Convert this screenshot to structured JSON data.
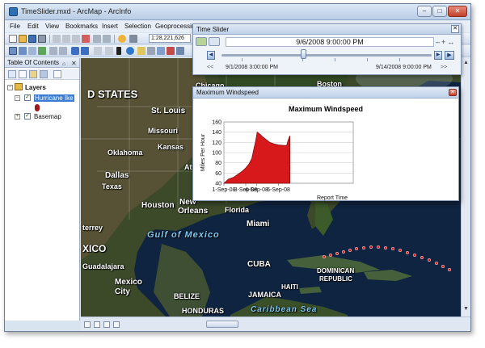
{
  "window": {
    "title": "TimeSlider.mxd - ArcMap - ArcInfo",
    "min_label": "–",
    "max_label": "□",
    "close_label": "✕"
  },
  "menubar": {
    "items": [
      "File",
      "Edit",
      "View",
      "Bookmarks",
      "Insert",
      "Selection",
      "Geoprocessing"
    ]
  },
  "toolbar": {
    "scale": "1:28,221,626"
  },
  "toc": {
    "title": "Table Of Contents",
    "pin": "⌂",
    "close": "✕",
    "layers_label": "Layers",
    "hurricane_label": "Hurricane Ike",
    "basemap_label": "Basemap"
  },
  "time_slider": {
    "title": "Time Slider",
    "current_time": "9/6/2008 9:00:00 PM",
    "start_time": "9/1/2008 3:00:00 PM",
    "end_time": "9/14/2008 9:00:00 PM",
    "zoom_controls": "–+↔",
    "back_label": "◀",
    "forward_label": "▶",
    "play_label": "▶",
    "start_nav": "<<",
    "end_nav": ">>",
    "close_label": "✕"
  },
  "graph_window": {
    "title": "Maximum Windspeed",
    "close_label": "✕"
  },
  "map_labels": {
    "states": "D STATES",
    "chicago": "Chicago",
    "boston": "Boston",
    "st_louis": "St. Louis",
    "missouri": "Missouri",
    "oklahoma": "Oklahoma",
    "kansas_city": "Kansas",
    "atlanta": "Atlanta",
    "dallas": "Dallas",
    "texas": "Texas",
    "houston": "Houston",
    "new_orleans_1": "New",
    "new_orleans_2": "Orleans",
    "florida": "Florida",
    "gulf": "Gulf of Mexico",
    "miami": "Miami",
    "terrey": "terrey",
    "mexico": "XICO",
    "guadalajara": "Guadalajara",
    "mexico_city_1": "Mexico",
    "mexico_city_2": "City",
    "cuba": "CUBA",
    "belize": "BELIZE",
    "haiti": "HAITI",
    "dominican_1": "DOMINICAN",
    "dominican_2": "REPUBLIC",
    "jamaica": "JAMAICA",
    "honduras": "HONDURAS",
    "caribbean": "Caribbean Sea"
  },
  "chart_data": {
    "type": "area",
    "title": "Maximum Windspeed",
    "xlabel": "Report Time",
    "ylabel": "Miles Per Hour",
    "ylim": [
      40,
      160
    ],
    "yticks": [
      40,
      60,
      80,
      100,
      120,
      140,
      160
    ],
    "xticks": [
      "1-Sep-08",
      "3-Sep-08",
      "4-Sep-08",
      "6-Sep-08"
    ],
    "grid": true,
    "x_range_days": [
      0,
      8
    ],
    "x_tick_days": [
      0,
      2,
      3,
      5
    ],
    "series": [
      {
        "color": "#d7191c",
        "x_days": [
          0.0,
          0.4,
          0.9,
          1.3,
          1.7,
          2.0,
          2.3,
          2.55,
          2.75,
          2.9,
          3.05,
          3.3,
          3.6,
          3.9,
          4.2,
          4.6,
          5.0,
          5.5,
          5.75,
          5.85,
          5.95,
          6.05
        ],
        "values": [
          40,
          48,
          52,
          58,
          64,
          70,
          78,
          88,
          108,
          122,
          140,
          136,
          130,
          125,
          120,
          117,
          115,
          114,
          114,
          122,
          128,
          133
        ]
      }
    ]
  }
}
